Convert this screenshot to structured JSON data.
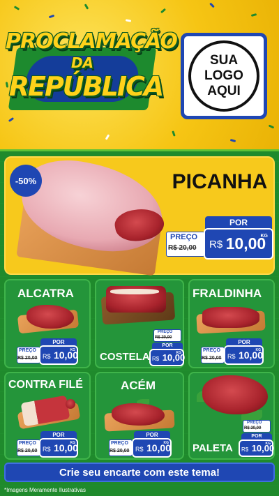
{
  "header": {
    "title_line1": "PROCLAMAÇÃO",
    "title_line2": "DA",
    "title_line3": "REPÚBLICA",
    "logo_line1": "SUA",
    "logo_line2": "LOGO",
    "logo_line3": "AQUI"
  },
  "featured": {
    "discount": "-50%",
    "name": "PICANHA",
    "por_label": "POR",
    "preco_label": "PREÇO",
    "old_price": "R$ 20,00",
    "currency": "R$",
    "new_price": "10,00",
    "unit": "KG"
  },
  "products": [
    {
      "name": "ALCATRA",
      "preco_label": "PREÇO",
      "por_label": "POR",
      "old_price": "R$ 20,00",
      "currency": "R$",
      "new_price": "10,00",
      "unit": "KG"
    },
    {
      "name": "COSTELA",
      "preco_label": "PREÇO",
      "por_label": "POR",
      "old_price": "R$ 20,00",
      "currency": "R$",
      "new_price": "10,00",
      "unit": "KG"
    },
    {
      "name": "FRALDINHA",
      "preco_label": "PREÇO",
      "por_label": "POR",
      "old_price": "R$ 20,00",
      "currency": "R$",
      "new_price": "10,00",
      "unit": "KG"
    },
    {
      "name": "CONTRA FILÉ",
      "preco_label": "PREÇO",
      "por_label": "POR",
      "old_price": "R$ 20,00",
      "currency": "R$",
      "new_price": "10,00",
      "unit": "KG"
    },
    {
      "name": "ACÉM",
      "preco_label": "PREÇO",
      "por_label": "POR",
      "old_price": "R$ 20,00",
      "currency": "R$",
      "new_price": "10,00",
      "unit": "KG"
    },
    {
      "name": "PALETA",
      "preco_label": "PREÇO",
      "por_label": "POR",
      "old_price": "R$ 20,00",
      "currency": "R$",
      "new_price": "10,00",
      "unit": "KG"
    }
  ],
  "cta": "Crie seu encarte com este tema!",
  "disclaimer": "*Imagens Meramente Ilustrativas",
  "colors": {
    "brand_blue": "#1f47b3",
    "green": "#1f8a2c",
    "yellow": "#f6c514"
  }
}
